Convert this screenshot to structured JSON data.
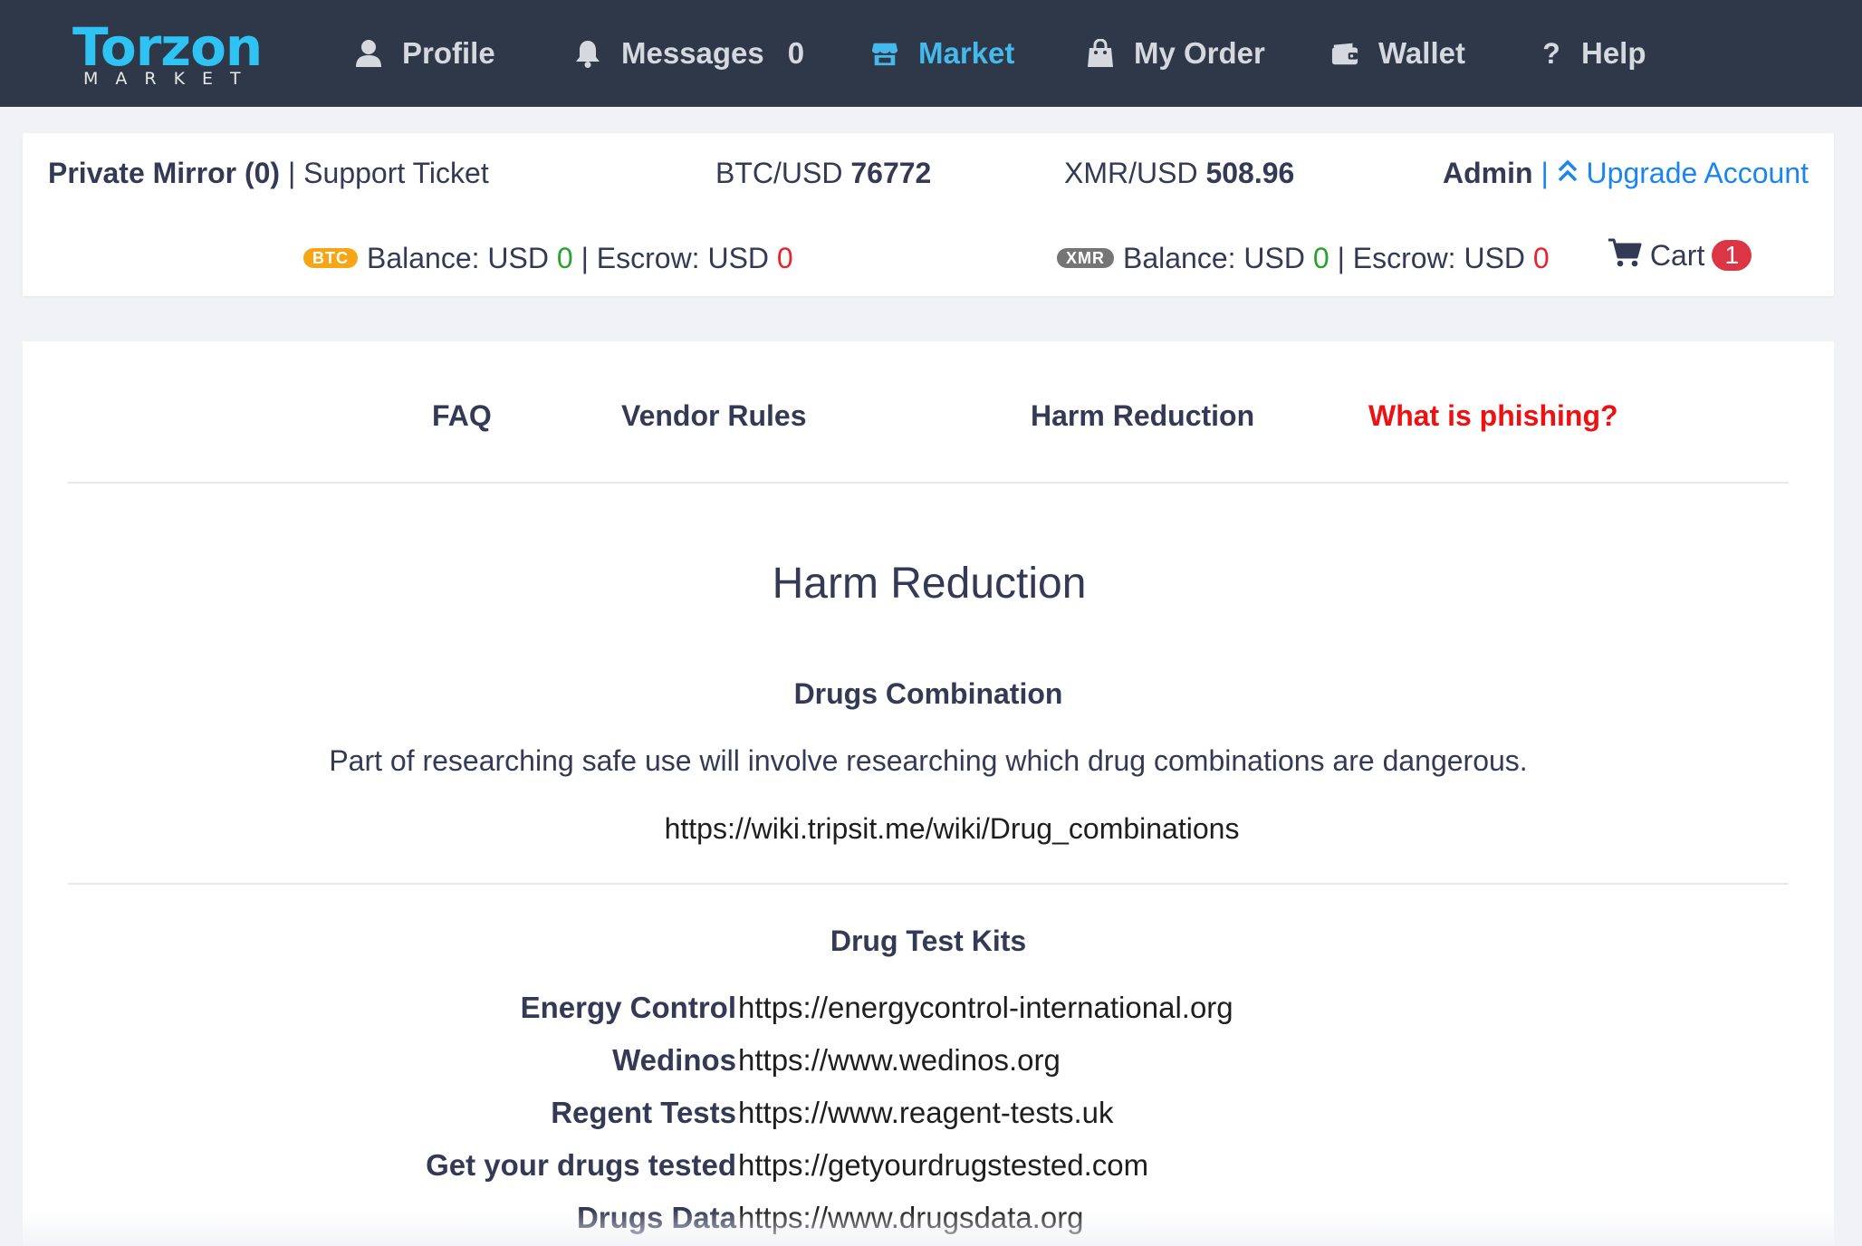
{
  "brand": {
    "name": "Torzon",
    "sub": "MARKET",
    "primary_color": "#2fc3f4"
  },
  "nav": {
    "profile": "Profile",
    "messages": "Messages",
    "messages_count": "0",
    "market": "Market",
    "my_order": "My Order",
    "wallet": "Wallet",
    "help": "Help"
  },
  "account": {
    "private_mirror": "Private Mirror (0)",
    "separator": "|",
    "support_ticket": "Support Ticket",
    "btc_usd_label": "BTC/USD",
    "btc_usd_value": "76772",
    "xmr_usd_label": "XMR/USD",
    "xmr_usd_value": "508.96",
    "admin": "Admin",
    "upgrade_account": "Upgrade Account",
    "btc_badge": "BTC",
    "xmr_badge": "XMR",
    "balance_label": "Balance: USD",
    "escrow_label": "| Escrow: USD",
    "btc_balance": "0",
    "btc_escrow": "0",
    "xmr_balance": "0",
    "xmr_escrow": "0",
    "cart_label": "Cart",
    "cart_count": "1"
  },
  "info_tabs": {
    "faq": "FAQ",
    "vendor_rules": "Vendor Rules",
    "harm_reduction": "Harm Reduction",
    "phishing": "What is phishing?"
  },
  "content": {
    "title": "Harm Reduction",
    "combination_heading": "Drugs Combination",
    "combination_text": "Part of researching safe use will involve researching which drug combinations are dangerous.",
    "combination_url": "https://wiki.tripsit.me/wiki/Drug_combinations",
    "test_kits_heading": "Drug Test Kits",
    "test_kits": [
      {
        "name": "Energy Control",
        "url": "https://energycontrol-international.org"
      },
      {
        "name": "Wedinos",
        "url": "https://www.wedinos.org"
      },
      {
        "name": "Regent Tests",
        "url": "https://www.reagent-tests.uk"
      },
      {
        "name": "Get your drugs tested",
        "url": "https://getyourdrugstested.com"
      },
      {
        "name": "Drugs Data",
        "url": "https://www.drugsdata.org"
      }
    ]
  },
  "colors": {
    "navbar_bg": "#2f3848",
    "nav_active": "#45b9ec",
    "link_blue": "#1a85f0",
    "positive_green": "#27a22a",
    "alert_red": "#e8232d",
    "btc_orange": "#f6a614",
    "xmr_gray": "#757575"
  }
}
